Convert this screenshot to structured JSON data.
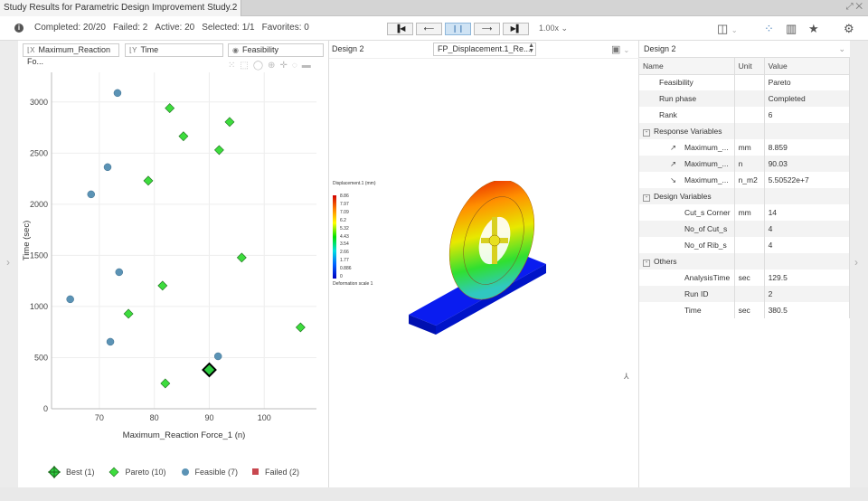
{
  "window": {
    "title": "Study Results for Parametric Design Improvement Study.2",
    "controls": "⤢ ✕"
  },
  "toolbar": {
    "status": [
      "Completed: 20/20",
      "Failed: 2",
      "Active: 20",
      "Selected: 1/1",
      "Favorites: 0"
    ],
    "player": [
      "first",
      "previous",
      "pause",
      "next",
      "last"
    ],
    "speed": "1.00x"
  },
  "left": {
    "x_field": "Maximum_Reaction Fo...",
    "y_field": "Time",
    "color_field": "Feasibility"
  },
  "mid": {
    "title": "Design 2",
    "result_select": "FP_Displacement.1_Re...",
    "legend_title": "Displacement.1 (mm)",
    "legend_values": [
      "8.86",
      "7.97",
      "7.09",
      "6.2",
      "5.32",
      "4.43",
      "3.54",
      "2.66",
      "1.77",
      "0.886",
      "0"
    ],
    "deformation": "Deformation scale 1"
  },
  "right": {
    "title": "Design 2",
    "columns": [
      "Name",
      "Unit",
      "Value"
    ],
    "rows": [
      {
        "name": "Feasibility",
        "unit": "",
        "value": "Pareto",
        "level": 1
      },
      {
        "name": "Run phase",
        "unit": "",
        "value": "Completed",
        "level": 1
      },
      {
        "name": "Rank",
        "unit": "",
        "value": "6",
        "level": 1
      },
      {
        "name": "Response Variables",
        "unit": "",
        "value": "",
        "level": 0,
        "group": true
      },
      {
        "name": "Maximum_...",
        "unit": "mm",
        "value": "8.859",
        "level": 2,
        "icon": "min"
      },
      {
        "name": "Maximum_...",
        "unit": "n",
        "value": "90.03",
        "level": 2,
        "icon": "min"
      },
      {
        "name": "Maximum_...",
        "unit": "n_m2",
        "value": "5.50522e+7",
        "level": 2,
        "icon": "constraint"
      },
      {
        "name": "Design Variables",
        "unit": "",
        "value": "",
        "level": 0,
        "group": true
      },
      {
        "name": "Cut_s Corner",
        "unit": "mm",
        "value": "14",
        "level": 2
      },
      {
        "name": "No_of Cut_s",
        "unit": "",
        "value": "4",
        "level": 2
      },
      {
        "name": "No_of Rib_s",
        "unit": "",
        "value": "4",
        "level": 2
      },
      {
        "name": "Others",
        "unit": "",
        "value": "",
        "level": 0,
        "group": true
      },
      {
        "name": "AnalysisTime",
        "unit": "sec",
        "value": "129.5",
        "level": 2
      },
      {
        "name": "Run ID",
        "unit": "",
        "value": "2",
        "level": 2
      },
      {
        "name": "Time",
        "unit": "sec",
        "value": "380.5",
        "level": 2
      }
    ]
  },
  "chart_data": {
    "type": "scatter",
    "xlabel": "Maximum_Reaction Force_1 (n)",
    "ylabel": "Time (sec)",
    "xlim": [
      61.3,
      109.5
    ],
    "ylim": [
      0,
      3290
    ],
    "xticks": [
      70,
      80,
      90,
      100
    ],
    "yticks": [
      0,
      500,
      1000,
      1500,
      2000,
      2500,
      3000
    ],
    "grid": true,
    "legend_position": "bottom",
    "series": [
      {
        "name": "Best (1)",
        "marker": "diamond-large",
        "color": "#2ecc40",
        "points": [
          [
            90,
            380.5
          ]
        ]
      },
      {
        "name": "Pareto (10)",
        "marker": "diamond",
        "color": "#3ddc3d",
        "points": [
          [
            82.8,
            2940
          ],
          [
            93.7,
            2805
          ],
          [
            85.3,
            2665
          ],
          [
            91.8,
            2530
          ],
          [
            78.9,
            2230
          ],
          [
            95.9,
            1478
          ],
          [
            81.5,
            1204
          ],
          [
            75.3,
            929
          ],
          [
            106.6,
            796
          ],
          [
            82.0,
            248
          ]
        ]
      },
      {
        "name": "Feasible (7)",
        "marker": "circle",
        "color": "#5b93b5",
        "points": [
          [
            73.3,
            3088
          ],
          [
            71.5,
            2363
          ],
          [
            68.5,
            2097
          ],
          [
            73.6,
            1336
          ],
          [
            64.7,
            1071
          ],
          [
            72.0,
            655
          ],
          [
            91.6,
            513
          ]
        ]
      },
      {
        "name": "Failed (2)",
        "marker": "square",
        "color": "#c8474f",
        "points": []
      }
    ]
  }
}
